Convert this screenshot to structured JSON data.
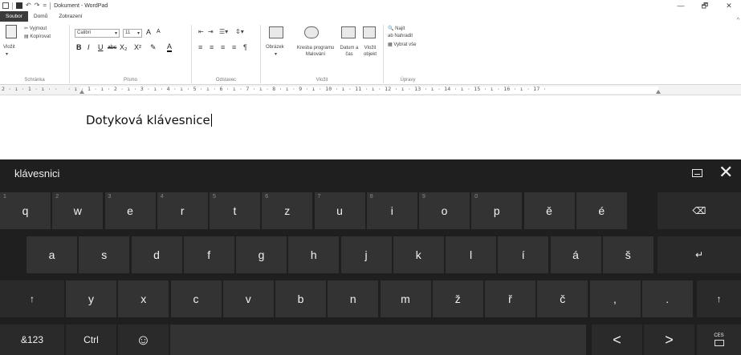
{
  "window": {
    "title": "Dokument - WordPad",
    "controls": {
      "minimize": "—",
      "maximize": "🗗",
      "close": "✕"
    },
    "help_icon": "^"
  },
  "quick_access": {
    "undo": "↶",
    "redo": "↷",
    "more": "="
  },
  "tabs": [
    "Soubor",
    "Domů",
    "Zobrazení"
  ],
  "ribbon": {
    "clipboard": {
      "paste": "Vložit",
      "cut": "Vyjmout",
      "copy": "Kopírovat",
      "label": "Schránka"
    },
    "font": {
      "name": "Calibri",
      "size": "11",
      "label": "Písmo",
      "grow": "A",
      "shrink": "A",
      "bold": "B",
      "italic": "I",
      "underline": "U",
      "strike": "abc",
      "sub": "X₂",
      "sup": "X²",
      "highlight": "✎",
      "color": "A"
    },
    "paragraph": {
      "label": "Odstavec"
    },
    "insert": {
      "picture": "Obrázek",
      "paint": "Kresba programu Malování",
      "datetime": "Datum a čas",
      "object": "Vložit objekt",
      "label": "Vložit"
    },
    "editing": {
      "find": "Najít",
      "replace": "Nahradit",
      "select_all": "Vybrat vše",
      "label": "Úpravy"
    }
  },
  "ruler": {
    "text": "2 · ı · 1 · ı · ·   · ı · 1 · ı · 2 · ı · 3 · ı · 4 · ı · 5 · ı · 6 · ı · 7 · ı · 8 · ı · 9 · ı · 10 · ı · 11 · ı · 12 · ı · 13 · ı · 14 · ı · 15 · ı · 16 · ı · 17 ·"
  },
  "document": {
    "text": "Dotyková klávesnice"
  },
  "keyboard": {
    "candidate": "klávesnici",
    "settings_icon": "keyboard-settings-icon",
    "close": "✕",
    "row1": [
      {
        "l": "q",
        "n": "1"
      },
      {
        "l": "w",
        "n": "2"
      },
      {
        "l": "e",
        "n": "3"
      },
      {
        "l": "r",
        "n": "4"
      },
      {
        "l": "t",
        "n": "5"
      },
      {
        "l": "z",
        "n": "6"
      },
      {
        "l": "u",
        "n": "7"
      },
      {
        "l": "i",
        "n": "8"
      },
      {
        "l": "o",
        "n": "9"
      },
      {
        "l": "p",
        "n": "0"
      },
      {
        "l": "ě",
        "n": ""
      },
      {
        "l": "é",
        "n": ""
      }
    ],
    "row2": [
      "a",
      "s",
      "d",
      "f",
      "g",
      "h",
      "j",
      "k",
      "l",
      "í",
      "á",
      "š"
    ],
    "row3": [
      "y",
      "x",
      "c",
      "v",
      "b",
      "n",
      "m",
      "ž",
      "ř",
      "č",
      ",",
      "."
    ],
    "backspace": "⌫",
    "enter": "↵",
    "shift": "↑",
    "symbols": "&123",
    "ctrl": "Ctrl",
    "emoji": "☺",
    "left": "<",
    "right": ">",
    "language": "CES"
  }
}
